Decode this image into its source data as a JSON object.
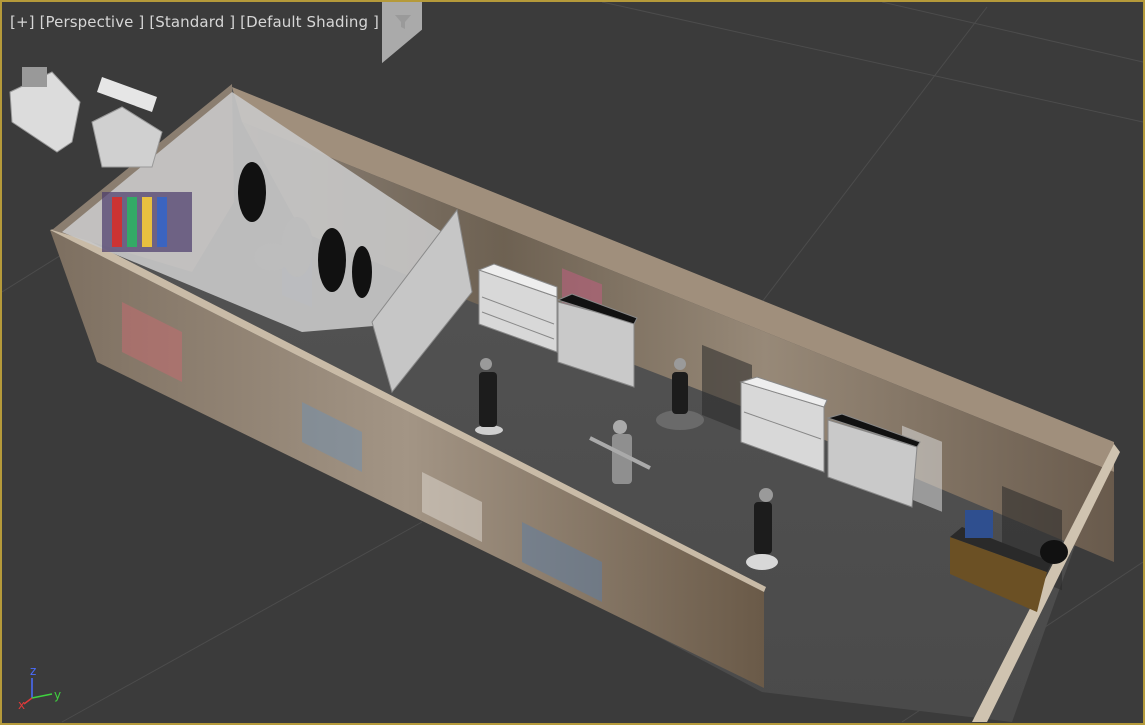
{
  "viewport": {
    "labels": {
      "plus": "[+]",
      "projection": "[Perspective ]",
      "style": "[Standard ]",
      "shading": "[Default Shading ]"
    },
    "filter_icon": "funnel-icon",
    "border_color": "#b59a3a",
    "background": "#3b3b3b"
  },
  "gizmo": {
    "z": "z",
    "y": "y",
    "x": "x",
    "z_color": "#4a6cff",
    "y_color": "#3fd23f",
    "x_color": "#e03a3a"
  }
}
